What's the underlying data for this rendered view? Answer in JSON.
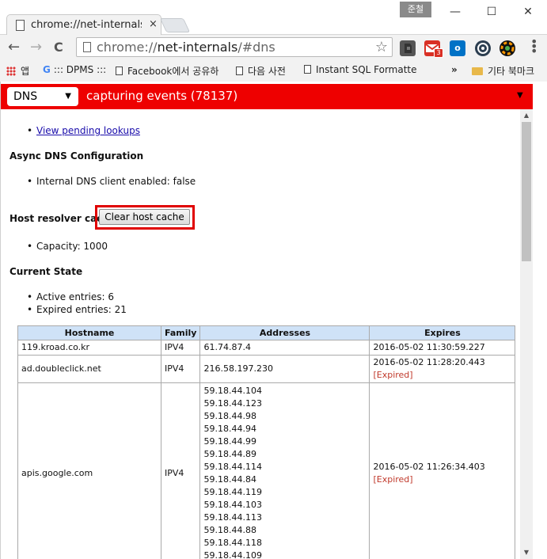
{
  "window": {
    "user_badge": "준철",
    "minimize": "—",
    "maximize": "☐",
    "close": "✕"
  },
  "tab": {
    "title": "chrome://net-internals/#dns",
    "close": "×"
  },
  "toolbar": {
    "back": "←",
    "forward": "→",
    "reload": "C",
    "url_scheme": "chrome://",
    "url_host": "net-internals",
    "url_path": "/#dns",
    "star": "☆"
  },
  "extensions": {
    "gmail_badge": "3",
    "outlook_label": "o"
  },
  "bookmarks": {
    "apps": "앱",
    "items": [
      "::: DPMS :::",
      "Facebook에서 공유하",
      "다음 사전",
      "Instant SQL Formatte"
    ],
    "overflow": "»",
    "other": "기타 북마크"
  },
  "netinternals": {
    "view_select": "DNS",
    "status": "capturing events (78137)",
    "pending_link": "View pending lookups",
    "async_heading": "Async DNS Configuration",
    "internal_dns": "Internal DNS client enabled: false",
    "host_cache_heading": "Host resolver cache",
    "clear_button": "Clear host cache",
    "capacity": "Capacity: 1000",
    "current_state_heading": "Current State",
    "active_entries": "Active entries: 6",
    "expired_entries": "Expired entries: 21"
  },
  "table": {
    "headers": [
      "Hostname",
      "Family",
      "Addresses",
      "Expires"
    ],
    "rows": [
      {
        "hostname": "119.kroad.co.kr",
        "family": "IPV4",
        "addresses": [
          "61.74.87.4"
        ],
        "expires": "2016-05-02 11:30:59.227",
        "expired": ""
      },
      {
        "hostname": "ad.doubleclick.net",
        "family": "IPV4",
        "addresses": [
          "216.58.197.230"
        ],
        "expires": "2016-05-02 11:28:20.443",
        "expired": "[Expired]"
      },
      {
        "hostname": "apis.google.com",
        "family": "IPV4",
        "addresses": [
          "59.18.44.104",
          "59.18.44.123",
          "59.18.44.98",
          "59.18.44.94",
          "59.18.44.99",
          "59.18.44.89",
          "59.18.44.114",
          "59.18.44.84",
          "59.18.44.119",
          "59.18.44.103",
          "59.18.44.113",
          "59.18.44.88",
          "59.18.44.118",
          "59.18.44.109"
        ],
        "expires": "2016-05-02 11:26:34.403",
        "expired": "[Expired]"
      }
    ]
  },
  "colors": {
    "header_red": "#ee0000",
    "table_header": "#cfe2f7",
    "expired": "#c0392b",
    "highlight": "#e00000"
  }
}
